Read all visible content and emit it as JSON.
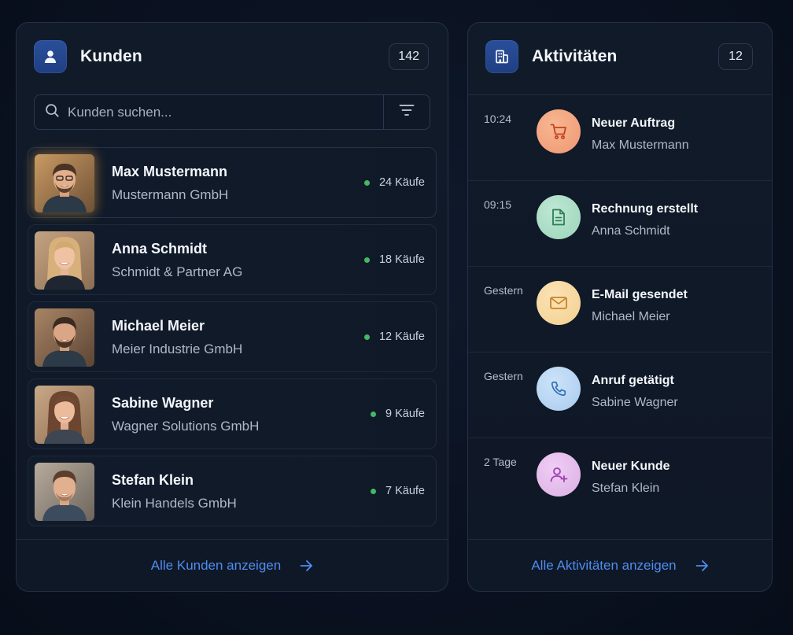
{
  "customers_panel": {
    "title": "Kunden",
    "count": "142",
    "icon": "user-icon",
    "search": {
      "placeholder": "Kunden suchen..."
    },
    "customers": [
      {
        "name": "Max Mustermann",
        "company": "Mustermann GmbH",
        "purchases": "24 Käufe",
        "status": "active"
      },
      {
        "name": "Anna Schmidt",
        "company": "Schmidt & Partner AG",
        "purchases": "18 Käufe",
        "status": "active"
      },
      {
        "name": "Michael Meier",
        "company": "Meier Industrie GmbH",
        "purchases": "12 Käufe",
        "status": "active"
      },
      {
        "name": "Sabine Wagner",
        "company": "Wagner Solutions GmbH",
        "purchases": "9 Käufe",
        "status": "active"
      },
      {
        "name": "Stefan Klein",
        "company": "Klein Handels GmbH",
        "purchases": "7 Käufe",
        "status": "active"
      }
    ],
    "footer_link": "Alle Kunden anzeigen"
  },
  "activities_panel": {
    "title": "Aktivitäten",
    "count": "12",
    "icon": "building-icon",
    "activities": [
      {
        "time": "10:24",
        "title": "Neuer Auftrag",
        "subtitle": "Max Mustermann",
        "icon": "cart-icon",
        "color": "#f0a27c"
      },
      {
        "time": "09:15",
        "title": "Rechnung erstellt",
        "subtitle": "Anna Schmidt",
        "icon": "document-icon",
        "color": "#a9dcc4"
      },
      {
        "time": "Gestern",
        "title": "E-Mail gesendet",
        "subtitle": "Michael Meier",
        "icon": "mail-icon",
        "color": "#f6d9a3"
      },
      {
        "time": "Gestern",
        "title": "Anruf getätigt",
        "subtitle": "Sabine Wagner",
        "icon": "phone-icon",
        "color": "#b4d3f3"
      },
      {
        "time": "2 Tage",
        "title": "Neuer Kunde",
        "subtitle": "Stefan Klein",
        "icon": "user-plus-icon",
        "color": "#e3b9ea"
      }
    ],
    "footer_link": "Alle Aktivitäten anzeigen"
  },
  "colors": {
    "accent": "#4f8cf0",
    "status_active": "#43b866",
    "background": "#0a1120"
  }
}
